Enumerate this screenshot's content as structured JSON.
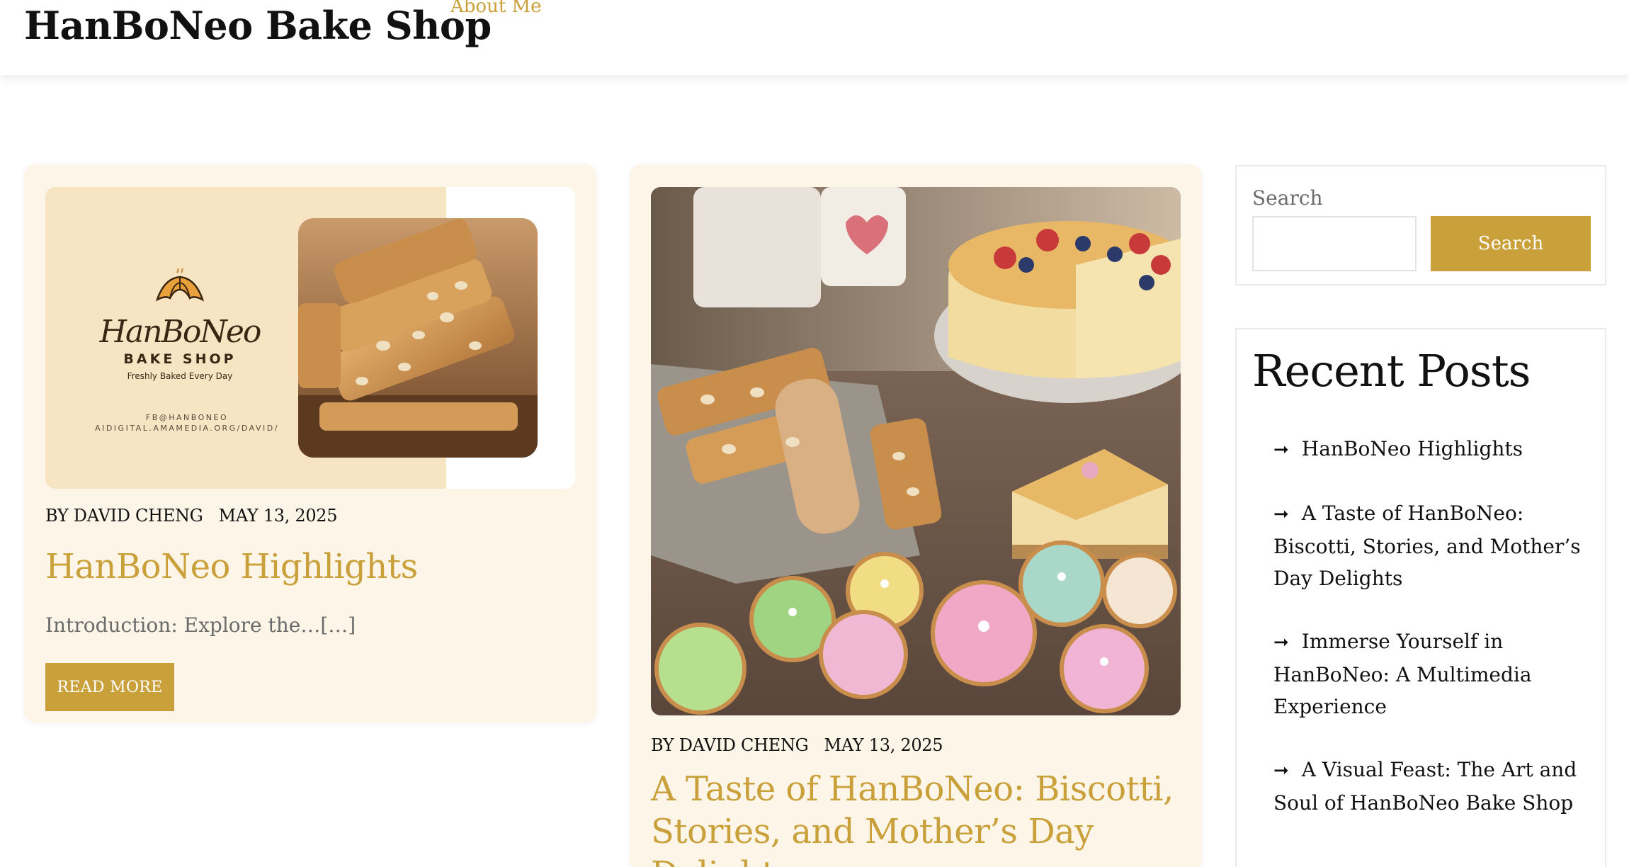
{
  "header": {
    "site_title": "HanBoNeo Bake Shop",
    "nav": [
      {
        "label": "About Me"
      }
    ]
  },
  "posts": [
    {
      "author": "BY DAVID CHENG",
      "date": "MAY 13, 2025",
      "title": "HanBoNeo Highlights",
      "excerpt": "Introduction: Explore the…[…]",
      "read_more": "READ MORE",
      "thumbnail": {
        "logo_word": "HanBoNeo",
        "logo_sub": "BAKE SHOP",
        "logo_tagline": "Freshly Baked Every Day",
        "contact_line1": "FB@HANBONEO",
        "contact_line2": "AIDIGITAL.AMAMEDIA.ORG/DAVID/"
      }
    },
    {
      "author": "BY DAVID CHENG",
      "date": "MAY 13, 2025",
      "title": "A Taste of HanBoNeo: Biscotti, Stories, and Mother’s Day Delights"
    }
  ],
  "sidebar": {
    "search": {
      "label": "Search",
      "value": "",
      "button_label": "Search"
    },
    "recent": {
      "title": "Recent Posts",
      "items": [
        {
          "label": "HanBoNeo Highlights"
        },
        {
          "label": "A Taste of HanBoNeo: Biscotti, Stories, and Mother’s Day Delights"
        },
        {
          "label": "Immerse Yourself in HanBoNeo: A Multimedia Experience"
        },
        {
          "label": "A Visual Feast: The Art and Soul of HanBoNeo Bake Shop"
        }
      ]
    }
  },
  "colors": {
    "accent": "#c9a03a",
    "card_bg": "#fdf6e8",
    "thumb_beige": "#f6e4c3"
  }
}
